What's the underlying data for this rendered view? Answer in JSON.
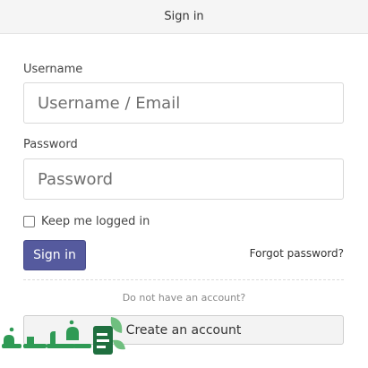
{
  "header": {
    "title": "Sign in"
  },
  "form": {
    "username_label": "Username",
    "username_placeholder": "Username / Email",
    "password_label": "Password",
    "password_placeholder": "Password",
    "remember_label": "Keep me logged in",
    "remember_checked": false,
    "signin_label": "Sign in",
    "forgot_label": "Forgot password?"
  },
  "footer": {
    "no_account_text": "Do not have an account?",
    "create_label": "Create an account"
  },
  "watermark": {
    "text": "فكرة"
  },
  "colors": {
    "primary_button": "#555a9e",
    "watermark_green": "#2f9a55",
    "header_bg": "#f5f5f5"
  }
}
